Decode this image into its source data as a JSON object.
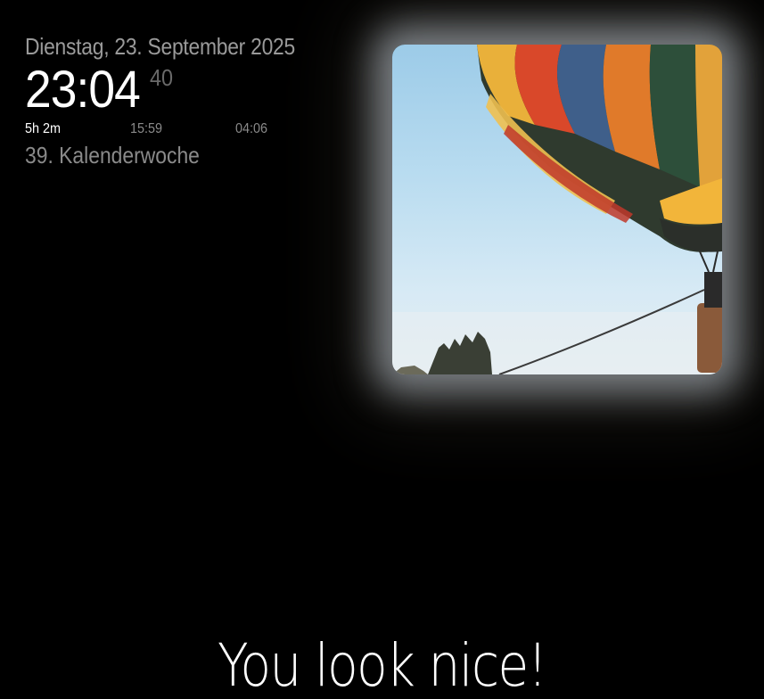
{
  "clock": {
    "date": "Dienstag, 23. September 2025",
    "time": "23:04",
    "seconds": "40",
    "sun_until": "5h 2m",
    "sunrise": "15:59",
    "sunset": "04:06",
    "week": "39. Kalenderwoche"
  },
  "photo": {
    "subject": "hot-air-balloon"
  },
  "compliment": {
    "text": "You look nice!"
  }
}
